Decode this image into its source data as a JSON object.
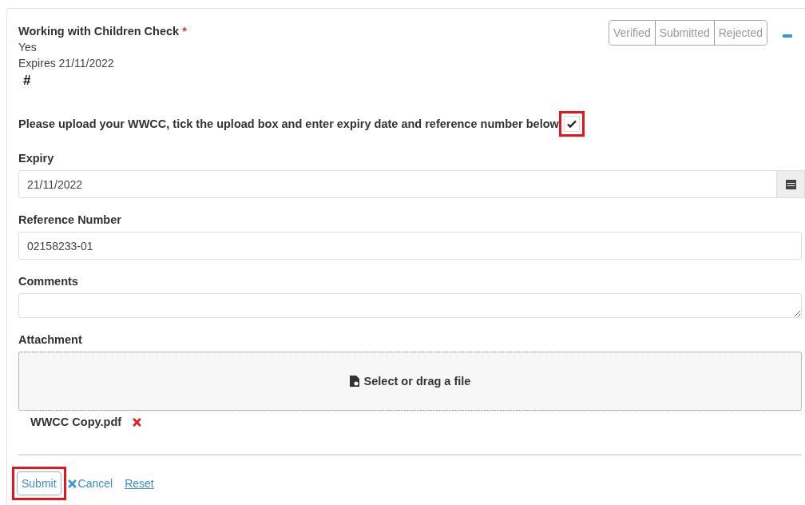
{
  "card": {
    "title": "Working with Children Check",
    "required_mark": "*",
    "lines": [
      "Yes",
      "Expires 21/11/2022"
    ],
    "hash": "#",
    "status_buttons": [
      {
        "label": "Verified",
        "selected": false
      },
      {
        "label": "Submitted",
        "selected": false
      },
      {
        "label": "Rejected",
        "selected": false
      }
    ],
    "collapsed": false,
    "prompt": "Please upload your WWCC, tick the upload box and enter expiry date and reference number below",
    "upload_checkbox": {
      "checked": true,
      "highlighted": true
    },
    "fields": [
      {
        "label": "Expiry",
        "value": "21/11/2022",
        "kind": "date"
      },
      {
        "label": "Reference Number",
        "value": "02158233-01",
        "kind": "text"
      },
      {
        "label": "Comments",
        "kind": "textarea"
      }
    ],
    "attachment": {
      "label": "Attachment",
      "dropzone": "Select or drag a file",
      "files": [
        "WWCC Copy.pdf"
      ]
    },
    "actions": {
      "submit": {
        "label": "Submit",
        "highlighted": true
      },
      "cancel": "Cancel",
      "reset": "Reset"
    }
  }
}
